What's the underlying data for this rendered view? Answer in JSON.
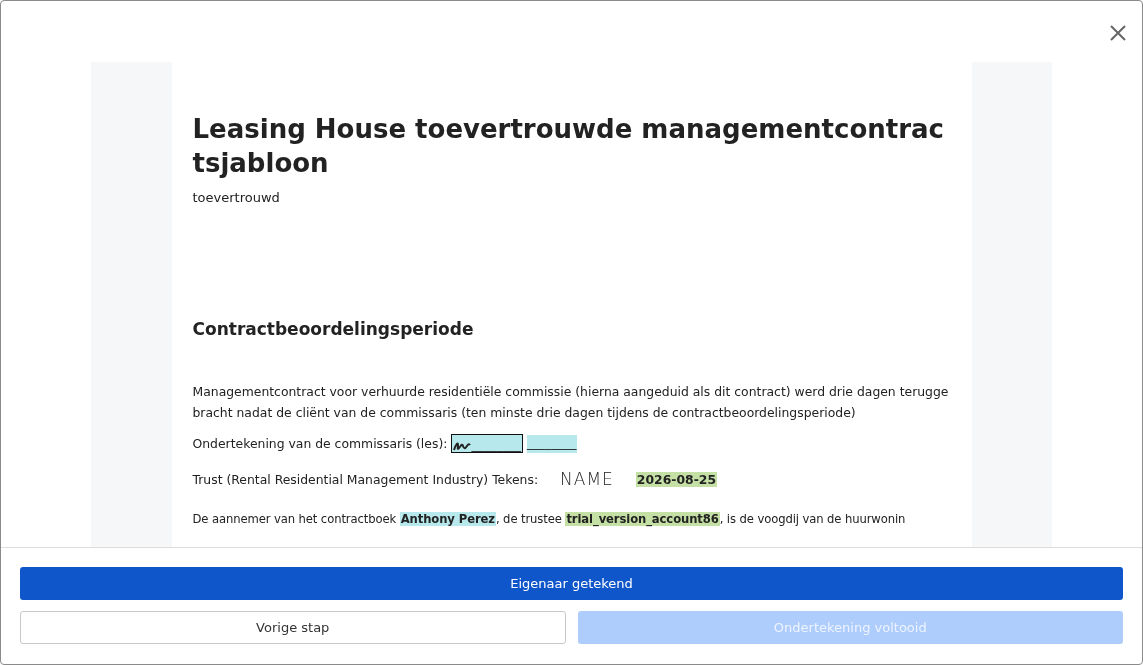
{
  "document": {
    "title": "Leasing House toevertrouwde managementcontractsjabloon",
    "subtitle": "toevertrouwd",
    "section_heading": "Contractbeoordelingsperiode",
    "paragraph": "Managementcontract voor verhuurde residentiële commissie (hierna aangeduid als dit contract) werd drie dagen teruggebracht nadat de cliënt van de commissaris (ten minste drie dagen tijdens de contractbeoordelingsperiode)",
    "commissioner_signature": {
      "label": "Ondertekening van de commissaris (les):",
      "signature_field": "________",
      "date_field": "________"
    },
    "trust_signature": {
      "label": "Trust (Rental Residential Management Industry) Tekens:",
      "signature": "NAME",
      "date": "2026-08-25"
    },
    "clause": [
      {
        "kind": "text",
        "text": "De aannemer van het contractboek "
      },
      {
        "kind": "field",
        "text": "Anthony Perez",
        "color": "#b6e8ec"
      },
      {
        "kind": "text",
        "text": ", de trustee "
      },
      {
        "kind": "field",
        "text": "trial_version_account86",
        "color": "#c5e0a5"
      },
      {
        "kind": "text",
        "text": ", is de voogdij van de huurwonin"
      }
    ]
  },
  "buttons": [
    {
      "label": "Eigenaar getekend",
      "kind": "primary",
      "disabled": false
    },
    {
      "label": "Vorige stap",
      "kind": "secondary",
      "disabled": false
    },
    {
      "label": "Ondertekening voltooid",
      "kind": "primary",
      "disabled": true
    }
  ]
}
